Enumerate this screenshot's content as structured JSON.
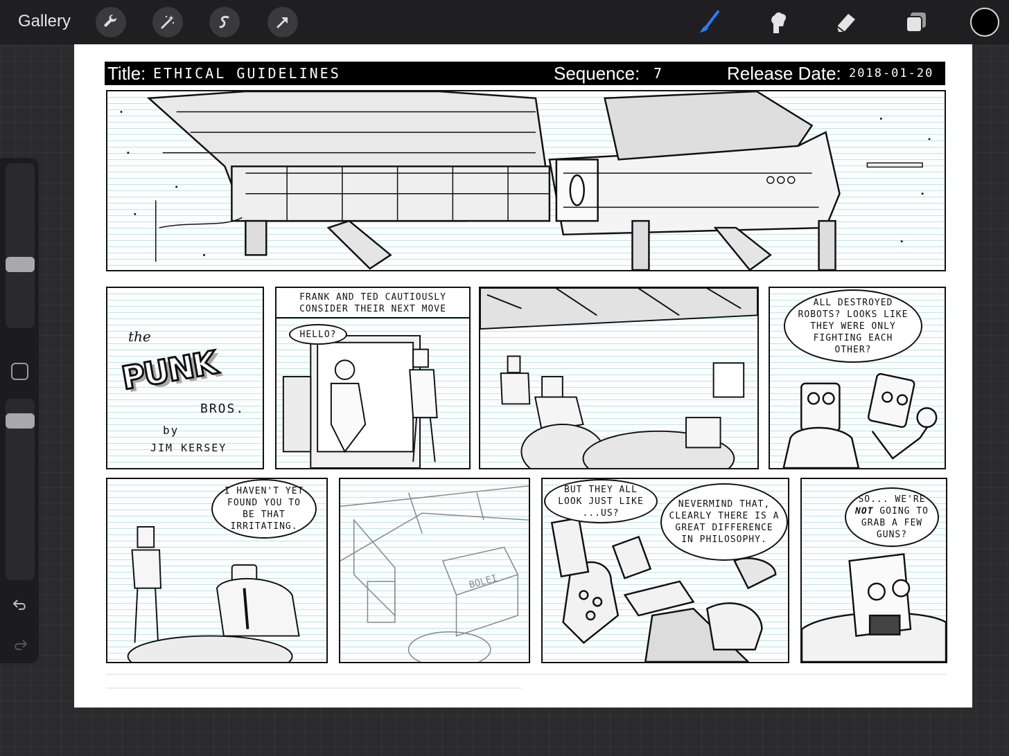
{
  "app": {
    "gallery_label": "Gallery",
    "toolbar_left": [
      {
        "name": "wrench-icon",
        "label": "Actions"
      },
      {
        "name": "magic-wand-icon",
        "label": "Adjustments"
      },
      {
        "name": "selection-icon",
        "label": "Selection"
      },
      {
        "name": "arrow-cursor-icon",
        "label": "Transform"
      }
    ],
    "toolbar_right": [
      {
        "name": "brush-icon",
        "active": true
      },
      {
        "name": "smudge-icon",
        "active": false
      },
      {
        "name": "eraser-icon",
        "active": false
      },
      {
        "name": "layers-icon",
        "active": false
      }
    ],
    "current_color": "#000000",
    "accent_color": "#2a7df0"
  },
  "sidebar": {
    "brush_size_level": 0.62,
    "opacity_level": 0.35,
    "modify_label": "",
    "undo_icon": "undo-icon",
    "redo_icon": "redo-icon"
  },
  "comic": {
    "header": {
      "title_label": "Title:",
      "title_value": "ETHICAL GUIDELINES",
      "sequence_label": "Sequence:",
      "sequence_value": "7",
      "release_label": "Release Date:",
      "release_value": "2018-01-20"
    },
    "logo": {
      "the": "the",
      "name": "PUNK",
      "bros": "BROS.",
      "by": "by",
      "author": "JIM KERSEY"
    },
    "captions": {
      "panel3": "FRANK AND TED CAUTIOUSLY CONSIDER THEIR NEXT MOVE"
    },
    "balloons": {
      "hello": "HELLO?",
      "destroyed": "ALL DESTROYED ROBOTS? LOOKS LIKE THEY WERE ONLY FIGHTING EACH OTHER?",
      "irritating": "I HAVEN'T YET FOUND YOU TO BE THAT IRRITATING.",
      "lookslike": "BUT THEY ALL LOOK JUST LIKE ...US?",
      "nevermind": "NEVERMIND THAT, CLEARLY THERE IS A GREAT DIFFERENCE IN PHILOSOPHY.",
      "guns_pre": "SO... WE'RE",
      "guns_not": "NOT",
      "guns_post": "GOING TO GRAB A FEW GUNS?"
    },
    "sign_text": "BOLEI"
  }
}
